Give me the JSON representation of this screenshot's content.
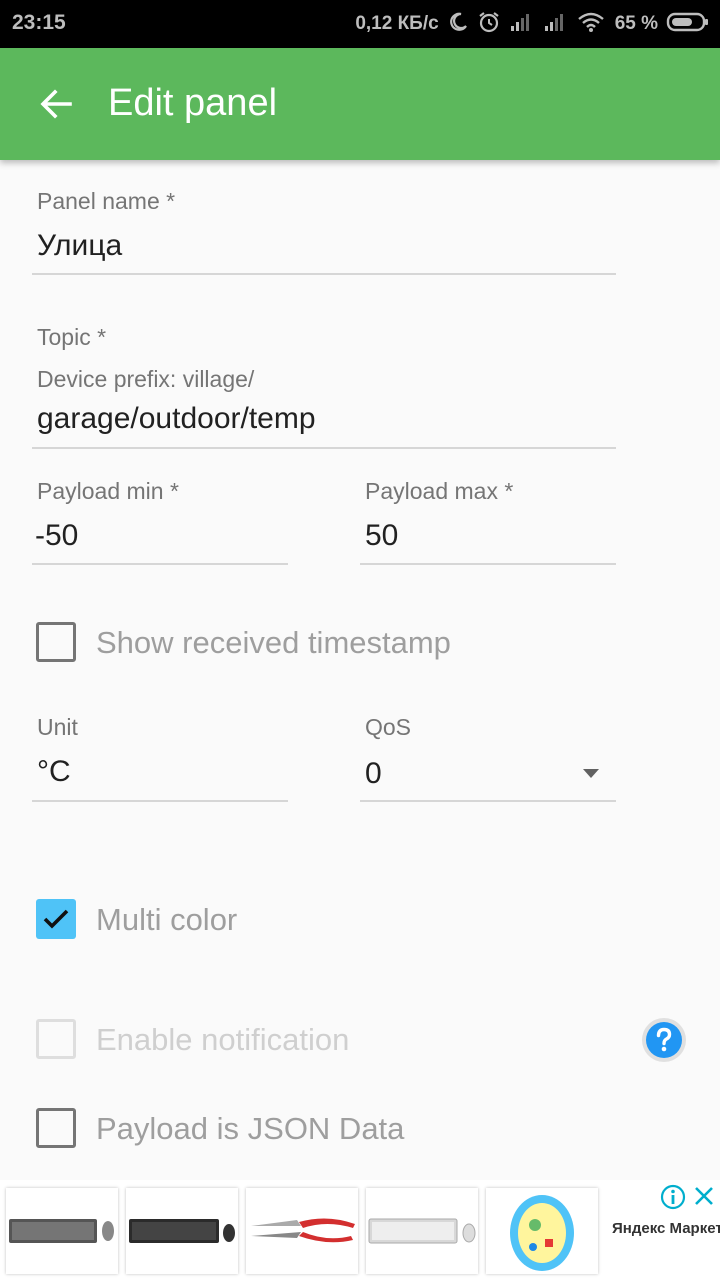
{
  "status_bar": {
    "time": "23:15",
    "network_speed": "0,12 КБ/с",
    "battery": "65 %"
  },
  "app_bar": {
    "title": "Edit panel",
    "back_icon": "arrow-back-icon"
  },
  "form": {
    "panel_name": {
      "label": "Panel name *",
      "value": "Улица"
    },
    "topic": {
      "label": "Topic *",
      "prefix": "Device prefix: village/",
      "value": "garage/outdoor/temp"
    },
    "payload_min": {
      "label": "Payload min *",
      "value": "-50"
    },
    "payload_max": {
      "label": "Payload max *",
      "value": "50"
    },
    "show_timestamp": {
      "label": "Show received timestamp",
      "checked": false
    },
    "unit": {
      "label": "Unit",
      "value": "°C"
    },
    "qos": {
      "label": "QoS",
      "value": "0"
    },
    "multi_color": {
      "label": "Multi color",
      "checked": true
    },
    "enable_notification": {
      "label": "Enable notification",
      "checked": false,
      "enabled": false
    },
    "payload_json": {
      "label": "Payload is JSON Data",
      "checked": false
    }
  },
  "ad": {
    "brand": "Яндекс Маркет",
    "items": [
      "keyboard-mouse-grey",
      "keyboard-mouse-black",
      "pruning-shears",
      "keyboard-mouse-white",
      "egg-toy"
    ]
  },
  "colors": {
    "app_bar": "#5cb85c",
    "checkbox_checked": "#4fc3f7",
    "help_icon": "#2196f3"
  }
}
